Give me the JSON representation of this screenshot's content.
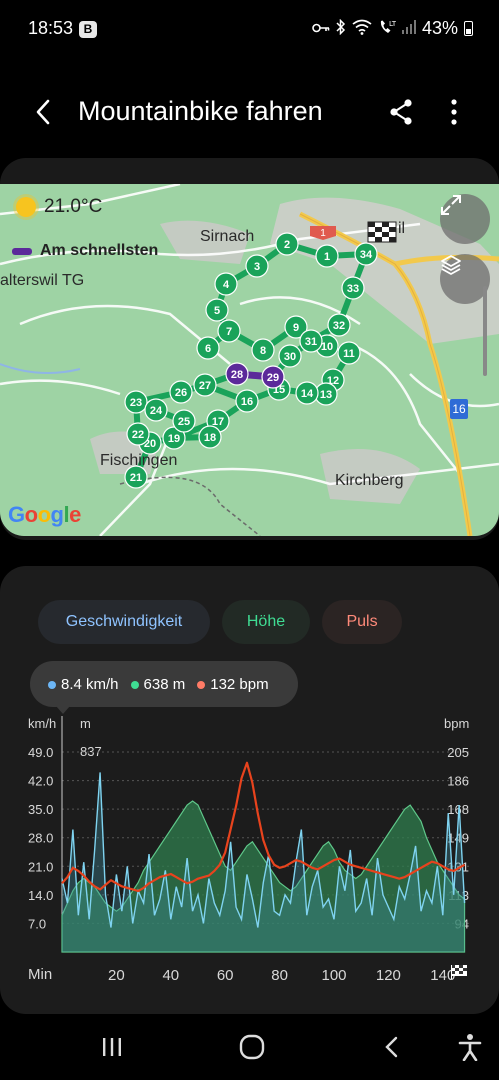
{
  "status_bar": {
    "time": "18:53",
    "badge": "B",
    "battery": "43%",
    "icons": [
      "key-icon",
      "bluetooth-icon",
      "wifi-icon",
      "call-icon",
      "signal-icon",
      "battery-icon"
    ]
  },
  "header": {
    "title": "Mountainbike fahren",
    "icons": [
      "back-arrow-icon",
      "share-icon",
      "more-vert-icon"
    ]
  },
  "map": {
    "temperature": "21.0°C",
    "fastest_label": "Am schnellsten",
    "fastest_color": "#5b2a9a",
    "route_color": "#1aa35a",
    "brand": "Google",
    "places": {
      "sirnach": "Sirnach",
      "alterswil": "alterswil TG",
      "fischingen": "Fischingen",
      "kirchberg": "Kirchberg",
      "wil": "il"
    },
    "road_badges": {
      "highway": "16",
      "road1": "1"
    },
    "checkpoints": [
      "1",
      "2",
      "3",
      "4",
      "5",
      "6",
      "7",
      "8",
      "9",
      "10",
      "11",
      "12",
      "13",
      "14",
      "15",
      "16",
      "17",
      "18",
      "19",
      "20",
      "21",
      "22",
      "23",
      "24",
      "25",
      "26",
      "27",
      "28",
      "29",
      "30",
      "31",
      "32",
      "33",
      "34"
    ],
    "buttons": [
      "fullscreen-icon",
      "layers-icon"
    ]
  },
  "chart": {
    "chips": {
      "speed": "Geschwindigkeit",
      "height": "Höhe",
      "pulse": "Puls"
    },
    "tooltip": {
      "speed": "8.4 km/h",
      "height": "638 m",
      "pulse": "132 bpm"
    },
    "colors": {
      "speed": "#7fd3f0",
      "height": "#2f7d4d",
      "pulse": "#e8431d",
      "pulse_low": "#f07a1a"
    },
    "left_unit": "km/h",
    "mid_unit": "m",
    "right_unit": "bpm",
    "x_unit": "Min",
    "max_height_label": "837"
  },
  "chart_data": {
    "type": "line",
    "x": [
      0,
      2,
      4,
      6,
      8,
      10,
      12,
      14,
      16,
      18,
      20,
      22,
      24,
      26,
      28,
      30,
      32,
      34,
      36,
      38,
      40,
      42,
      44,
      46,
      48,
      50,
      52,
      54,
      56,
      58,
      60,
      62,
      64,
      66,
      68,
      70,
      72,
      74,
      76,
      78,
      80,
      82,
      84,
      86,
      88,
      90,
      92,
      94,
      96,
      98,
      100,
      102,
      104,
      106,
      108,
      110,
      112,
      114,
      116,
      118,
      120,
      122,
      124,
      126,
      128,
      130,
      132,
      134,
      136,
      138,
      140,
      142,
      144,
      146,
      148
    ],
    "x_ticks": [
      "20",
      "40",
      "60",
      "80",
      "100",
      "120",
      "140"
    ],
    "xlabel": "Min",
    "xlim": [
      0,
      150
    ],
    "y_left_ticks": [
      "49.0",
      "42.0",
      "35.0",
      "28.0",
      "21.0",
      "14.0",
      "7.0"
    ],
    "y_left_label": "km/h",
    "y_left_lim": [
      0,
      49
    ],
    "y_right_ticks": [
      "205",
      "186",
      "168",
      "149",
      "131",
      "113",
      "94"
    ],
    "y_right_label": "bpm",
    "series": [
      {
        "name": "Geschwindigkeit",
        "axis": "left",
        "values": [
          18,
          12,
          30,
          9,
          22,
          8,
          25,
          44,
          14,
          6,
          19,
          10,
          21,
          7,
          15,
          12,
          24,
          9,
          13,
          20,
          8,
          16,
          11,
          23,
          10,
          14,
          7,
          18,
          12,
          9,
          15,
          27,
          11,
          8,
          19,
          13,
          6,
          17,
          24,
          10,
          9,
          14,
          12,
          22,
          30,
          9,
          16,
          20,
          11,
          13,
          8,
          21,
          15,
          25,
          10,
          12,
          18,
          9,
          23,
          14,
          11,
          8,
          16,
          13,
          19,
          26,
          10,
          15,
          12,
          21,
          9,
          34,
          14,
          36,
          12
        ]
      },
      {
        "name": "Höhe",
        "axis": "left",
        "values": [
          9,
          12,
          15,
          17,
          18,
          17,
          16,
          14,
          12,
          11,
          10,
          11,
          13,
          15,
          17,
          20,
          22,
          24,
          26,
          28,
          30,
          32,
          34,
          36,
          37,
          36,
          33,
          30,
          27,
          24,
          21,
          20,
          22,
          24,
          26,
          27,
          25,
          23,
          21,
          19,
          17,
          16,
          15,
          16,
          18,
          20,
          22,
          24,
          26,
          27,
          25,
          22,
          20,
          19,
          18,
          19,
          21,
          23,
          25,
          27,
          29,
          31,
          33,
          35,
          36,
          34,
          32,
          28,
          25,
          22,
          20,
          18,
          16,
          14,
          13
        ]
      },
      {
        "name": "Puls",
        "axis": "right",
        "values": [
          120,
          124,
          130,
          128,
          125,
          121,
          118,
          116,
          119,
          122,
          120,
          118,
          117,
          116,
          115,
          117,
          120,
          122,
          124,
          125,
          126,
          124,
          122,
          120,
          121,
          123,
          124,
          125,
          128,
          132,
          140,
          155,
          170,
          188,
          198,
          185,
          165,
          148,
          138,
          132,
          130,
          131,
          133,
          135,
          134,
          132,
          130,
          129,
          131,
          133,
          135,
          136,
          134,
          132,
          131,
          130,
          129,
          128,
          127,
          126,
          125,
          124,
          123,
          124,
          126,
          128,
          130,
          132,
          134,
          133,
          131,
          129,
          128,
          130,
          132
        ]
      }
    ]
  }
}
